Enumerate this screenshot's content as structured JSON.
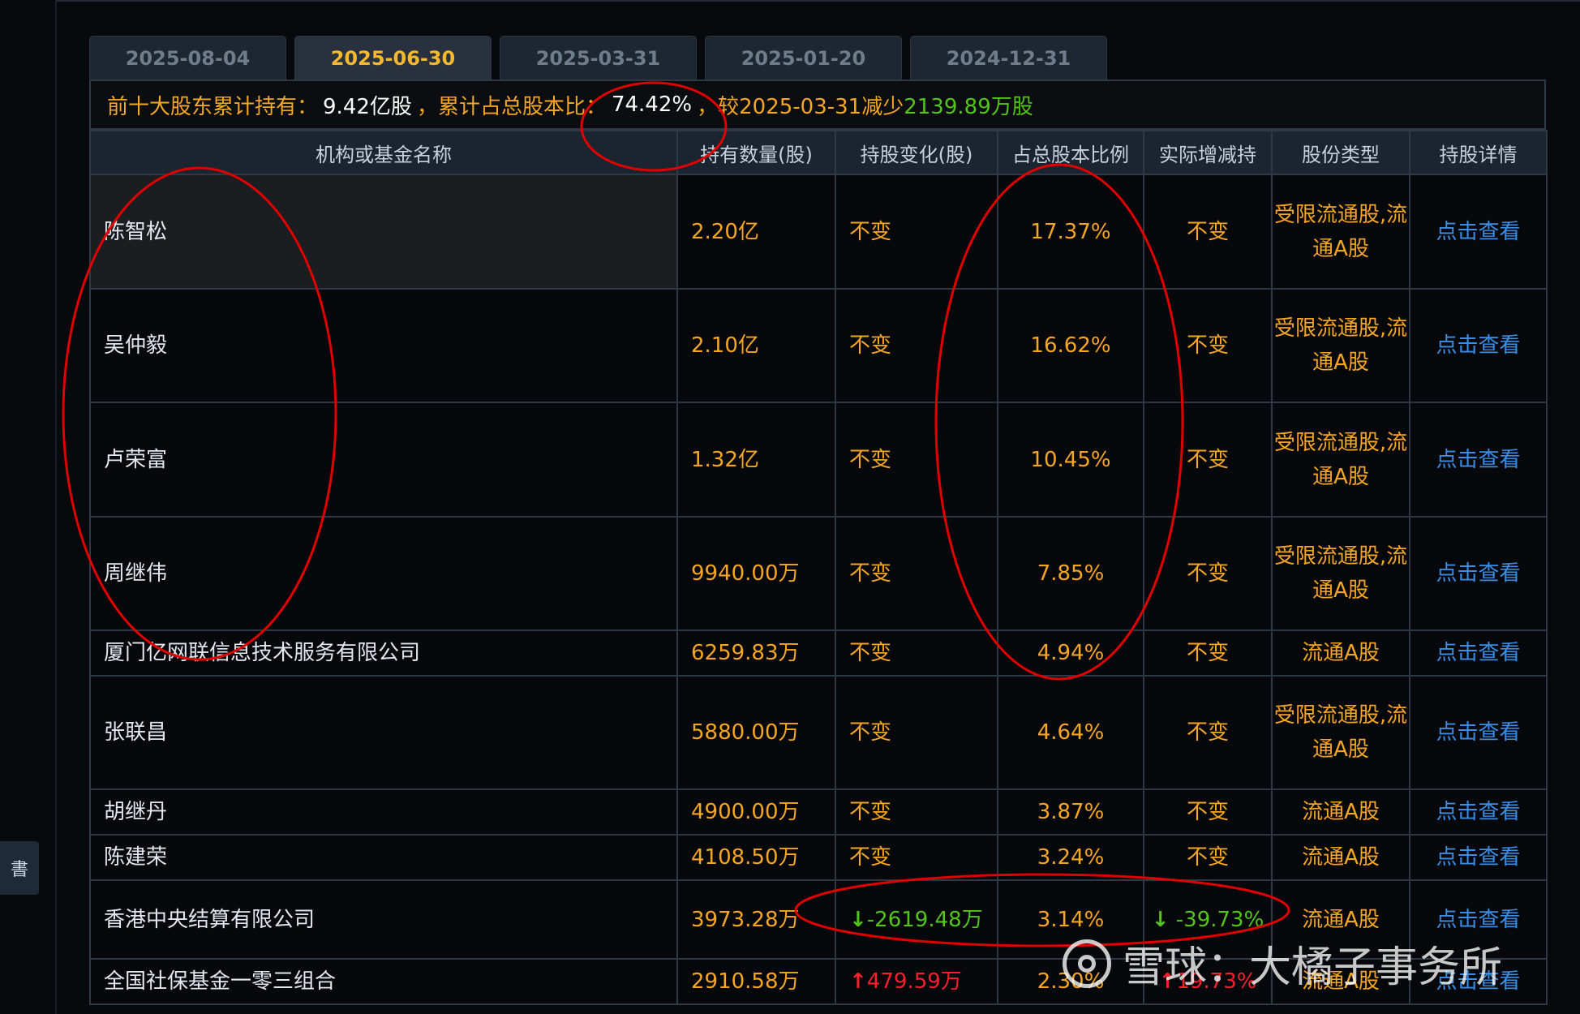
{
  "tabs": [
    {
      "label": "2025-08-04",
      "active": false
    },
    {
      "label": "2025-06-30",
      "active": true
    },
    {
      "label": "2025-03-31",
      "active": false
    },
    {
      "label": "2025-01-20",
      "active": false
    },
    {
      "label": "2024-12-31",
      "active": false
    }
  ],
  "summary": {
    "label_hold": "前十大股东累计持有：",
    "hold_value": "9.42亿股",
    "sep1": "，",
    "label_ratio": "累计占总股本比：",
    "ratio_value": "74.42%",
    "sep2": "，",
    "label_compare": "较2025-03-31减少",
    "change_value": "2139.89万股"
  },
  "table": {
    "headers": [
      "机构或基金名称",
      "持有数量(股)",
      "持股变化(股)",
      "占总股本比例",
      "实际增减持",
      "股份类型",
      "持股详情"
    ],
    "rows": [
      {
        "name": "陈智松",
        "qty": "2.20亿",
        "change": "不变",
        "ratio": "17.37%",
        "actual": "不变",
        "type": "受限流通股,流通A股",
        "detail": "点击查看"
      },
      {
        "name": "吴仲毅",
        "qty": "2.10亿",
        "change": "不变",
        "ratio": "16.62%",
        "actual": "不变",
        "type": "受限流通股,流通A股",
        "detail": "点击查看"
      },
      {
        "name": "卢荣富",
        "qty": "1.32亿",
        "change": "不变",
        "ratio": "10.45%",
        "actual": "不变",
        "type": "受限流通股,流通A股",
        "detail": "点击查看"
      },
      {
        "name": "周继伟",
        "qty": "9940.00万",
        "change": "不变",
        "ratio": "7.85%",
        "actual": "不变",
        "type": "受限流通股,流通A股",
        "detail": "点击查看"
      },
      {
        "name": "厦门亿网联信息技术服务有限公司",
        "qty": "6259.83万",
        "change": "不变",
        "ratio": "4.94%",
        "actual": "不变",
        "type": "流通A股",
        "detail": "点击查看"
      },
      {
        "name": "张联昌",
        "qty": "5880.00万",
        "change": "不变",
        "ratio": "4.64%",
        "actual": "不变",
        "type": "受限流通股,流通A股",
        "detail": "点击查看"
      },
      {
        "name": "胡继丹",
        "qty": "4900.00万",
        "change": "不变",
        "ratio": "3.87%",
        "actual": "不变",
        "type": "流通A股",
        "detail": "点击查看"
      },
      {
        "name": "陈建荣",
        "qty": "4108.50万",
        "change": "不变",
        "ratio": "3.24%",
        "actual": "不变",
        "type": "流通A股",
        "detail": "点击查看"
      },
      {
        "name": "香港中央结算有限公司",
        "qty": "3973.28万",
        "change": "-2619.48万",
        "ratio": "3.14%",
        "actual": "-39.73%",
        "type": "流通A股",
        "detail": "点击查看"
      },
      {
        "name": "全国社保基金一零三组合",
        "qty": "2910.58万",
        "change": "479.59万",
        "ratio": "2.30%",
        "actual": "19.73%",
        "type": "流通A股",
        "detail": "点击查看"
      }
    ]
  },
  "side": {
    "label": "書"
  },
  "watermark": {
    "text": "雪球：大橘子事务所"
  },
  "colors": {
    "accent": "#f5a623",
    "tab_active": "#f5b82e",
    "decrease": "#52c41a",
    "increase": "#f5222d",
    "link": "#3a8ee6",
    "annotation": "#e00000"
  }
}
